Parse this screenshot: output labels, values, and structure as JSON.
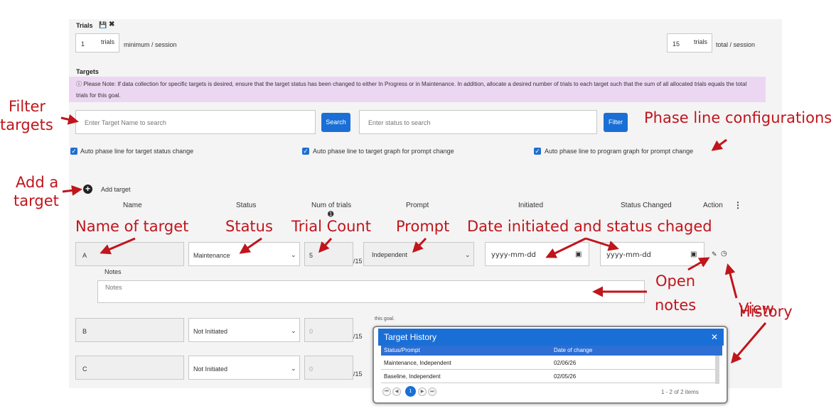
{
  "trials": {
    "title": "Trials",
    "min_value": "1",
    "min_unit": "trials",
    "min_label": "minimum / session",
    "total_value": "15",
    "total_unit": "trials",
    "total_label": "total / session"
  },
  "targets": {
    "title": "Targets",
    "note": "Please Note: If data collection for specific targets is desired, ensure that the target status has been changed to either In Progress or in Maintenance. In addition, allocate a desired number of trials to each target such that the sum of all allocated trials equals the total trials for this goal.",
    "search_placeholder": "Enter Target Name to search",
    "search_button": "Search",
    "status_placeholder": "Enter status to search",
    "filter_button": "Filter",
    "checkboxes": [
      "Auto phase line for target status change",
      "Auto phase line to target graph for prompt change",
      "Auto phase line to program graph for prompt change"
    ],
    "add_target": "Add target",
    "columns": [
      "Name",
      "Status",
      "Num of trials",
      "Prompt",
      "Initiated",
      "Status Changed",
      "Action"
    ],
    "rows": [
      {
        "name": "A",
        "status": "Maintenance",
        "trials": "5",
        "of_total": "/15",
        "prompt": "Independent",
        "initiated": "yyyy-mm-dd",
        "changed": "yyyy-mm-dd"
      },
      {
        "name": "B",
        "status": "Not Initiated",
        "trials": "0",
        "of_total": "/15"
      },
      {
        "name": "C",
        "status": "Not Initiated",
        "trials": "0",
        "of_total": "/15"
      }
    ],
    "notes_label": "Notes",
    "notes_placeholder": "Notes",
    "hidden_fragment": "this goal."
  },
  "history": {
    "title": "Target History",
    "columns": [
      "Status/Prompt",
      "Date of change"
    ],
    "rows": [
      {
        "status": "Maintenance, Independent",
        "date": "02/06/26"
      },
      {
        "status": "Baseline, Independent",
        "date": "02/05/26"
      }
    ],
    "page": "1",
    "pager_info": "1 - 2 of 2 items"
  },
  "annotations": {
    "filter_targets": [
      "Filter",
      "targets"
    ],
    "add_target": [
      "Add a",
      "target"
    ],
    "phase_line": "Phase line configurations",
    "name_of_target": "Name of target",
    "status": "Status",
    "trial_count": "Trial Count",
    "prompt": "Prompt",
    "date": "Date initiated and status chaged",
    "open_notes": [
      "Open",
      "notes"
    ],
    "view_history": [
      "View",
      "History"
    ]
  },
  "colors": {
    "accent": "#1a6fd6",
    "annotation": "#c0151c",
    "note_bg": "#ecd7f2"
  },
  "icons": [
    "save-icon",
    "close-icon",
    "info-icon",
    "plus-circle-icon",
    "kebab-menu-icon",
    "calendar-icon",
    "notes-icon",
    "history-icon",
    "chevron-down-icon"
  ]
}
